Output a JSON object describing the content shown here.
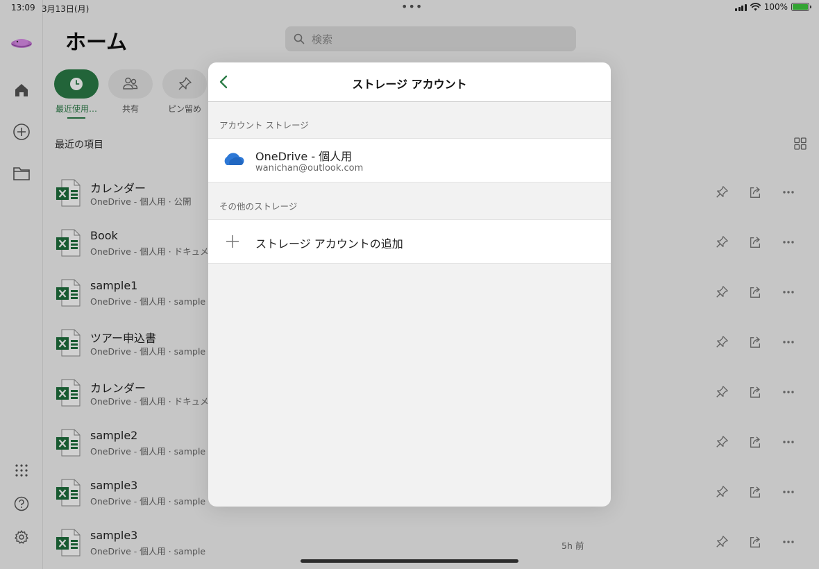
{
  "status_bar": {
    "time": "13:09",
    "date": "3月13日(月)",
    "battery": "100%",
    "battery_color": "#3ec83e"
  },
  "colors": {
    "accent": "#2a7b46",
    "excel_green": "#1e6e3c",
    "onedrive_blue": "#2d78d6"
  },
  "sidebar": {
    "items": [
      {
        "icon": "avatar"
      },
      {
        "icon": "home-icon"
      },
      {
        "icon": "add-icon"
      },
      {
        "icon": "folder-icon"
      },
      {
        "icon": "apps-grid-icon"
      },
      {
        "icon": "help-icon"
      },
      {
        "icon": "settings-icon"
      }
    ]
  },
  "header": {
    "title": "ホーム",
    "search_placeholder": "検索"
  },
  "tabs": [
    {
      "label": "最近使用…",
      "icon": "clock-icon",
      "active": true
    },
    {
      "label": "共有",
      "icon": "people-icon",
      "active": false
    },
    {
      "label": "ピン留め",
      "icon": "pin-icon",
      "active": false
    }
  ],
  "recent": {
    "section_label": "最近の項目",
    "files": [
      {
        "name": "カレンダー",
        "path": "OneDrive - 個人用 · 公開",
        "time": ""
      },
      {
        "name": "Book",
        "path": "OneDrive - 個人用 · ドキュメン",
        "time": ""
      },
      {
        "name": "sample1",
        "path": "OneDrive - 個人用 · sample",
        "time": ""
      },
      {
        "name": "ツアー申込書",
        "path": "OneDrive - 個人用 · sample",
        "time": ""
      },
      {
        "name": "カレンダー",
        "path": "OneDrive - 個人用 · ドキュメン",
        "time": ""
      },
      {
        "name": "sample2",
        "path": "OneDrive - 個人用 · sample",
        "time": ""
      },
      {
        "name": "sample3",
        "path": "OneDrive - 個人用 · sample",
        "time": ""
      },
      {
        "name": "sample3",
        "path": "OneDrive - 個人用 · sample",
        "time": "5h 前"
      }
    ]
  },
  "modal": {
    "title": "ストレージ アカウント",
    "account_section": "アカウント ストレージ",
    "account": {
      "name": "OneDrive - 個人用",
      "email": "wanichan@outlook.com"
    },
    "other_section": "その他のストレージ",
    "add_label": "ストレージ アカウントの追加"
  }
}
